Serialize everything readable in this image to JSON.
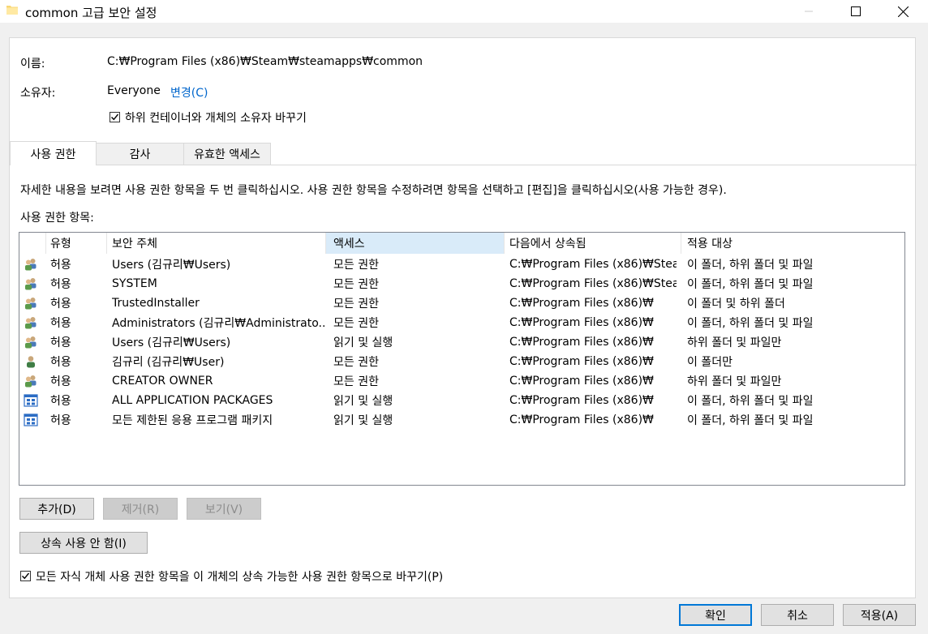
{
  "window": {
    "title": "common 고급 보안 설정",
    "min_symbol": "—",
    "max_symbol": "☐",
    "close_symbol": "✕"
  },
  "info": {
    "name_label": "이름:",
    "name_value": "C:₩Program Files (x86)₩Steam₩steamapps₩common",
    "owner_label": "소유자:",
    "owner_value": "Everyone",
    "change_link": "변경(C)",
    "replace_owner_checkbox": "하위 컨테이너와 개체의 소유자 바꾸기",
    "replace_owner_checked": true
  },
  "tabs": [
    {
      "label": "사용 권한",
      "active": true
    },
    {
      "label": "감사",
      "active": false
    },
    {
      "label": "유효한 액세스",
      "active": false
    }
  ],
  "instructions": "자세한 내용을 보려면 사용 권한 항목을 두 번 클릭하십시오. 사용 권한 항목을 수정하려면 항목을 선택하고 [편집]을 클릭하십시오(사용 가능한 경우).",
  "entries_label": "사용 권한 항목:",
  "table": {
    "columns": [
      "유형",
      "보안 주체",
      "액세스",
      "다음에서 상속됨",
      "적용 대상"
    ],
    "sorted_column": 2,
    "rows": [
      {
        "icon": "users-group-icon",
        "type": "허용",
        "principal": "Users (김규리₩Users)",
        "access": "모든 권한",
        "inherited": "C:₩Program Files (x86)₩Stea...",
        "applies": "이 폴더, 하위 폴더 및 파일"
      },
      {
        "icon": "users-group-icon",
        "type": "허용",
        "principal": "SYSTEM",
        "access": "모든 권한",
        "inherited": "C:₩Program Files (x86)₩Stea...",
        "applies": "이 폴더, 하위 폴더 및 파일"
      },
      {
        "icon": "users-group-icon",
        "type": "허용",
        "principal": "TrustedInstaller",
        "access": "모든 권한",
        "inherited": "C:₩Program Files (x86)₩",
        "applies": "이 폴더 및 하위 폴더"
      },
      {
        "icon": "users-group-icon",
        "type": "허용",
        "principal": "Administrators (김규리₩Administrato...",
        "access": "모든 권한",
        "inherited": "C:₩Program Files (x86)₩",
        "applies": "이 폴더, 하위 폴더 및 파일"
      },
      {
        "icon": "users-group-icon",
        "type": "허용",
        "principal": "Users (김규리₩Users)",
        "access": "읽기 및 실행",
        "inherited": "C:₩Program Files (x86)₩",
        "applies": "하위 폴더 및 파일만"
      },
      {
        "icon": "single-user-icon",
        "type": "허용",
        "principal": "김규리 (김규리₩User)",
        "access": "모든 권한",
        "inherited": "C:₩Program Files (x86)₩",
        "applies": "이 폴더만"
      },
      {
        "icon": "users-group-icon",
        "type": "허용",
        "principal": "CREATOR OWNER",
        "access": "모든 권한",
        "inherited": "C:₩Program Files (x86)₩",
        "applies": "하위 폴더 및 파일만"
      },
      {
        "icon": "app-package-icon",
        "type": "허용",
        "principal": "ALL APPLICATION PACKAGES",
        "access": "읽기 및 실행",
        "inherited": "C:₩Program Files (x86)₩",
        "applies": "이 폴더, 하위 폴더 및 파일"
      },
      {
        "icon": "app-package-icon",
        "type": "허용",
        "principal": "모든 제한된 응용 프로그램 패키지",
        "access": "읽기 및 실행",
        "inherited": "C:₩Program Files (x86)₩",
        "applies": "이 폴더, 하위 폴더 및 파일"
      }
    ]
  },
  "buttons": {
    "add": "추가(D)",
    "remove": "제거(R)",
    "view": "보기(V)",
    "disable_inheritance": "상속 사용 안 함(I)",
    "ok": "확인",
    "cancel": "취소",
    "apply": "적용(A)"
  },
  "replace_child_checkbox": "모든 자식 개체 사용 권한 항목을 이 개체의 상속 가능한 사용 권한 항목으로 바꾸기(P)",
  "replace_child_checked": true,
  "colors": {
    "link": "#0066cc",
    "sorted_header": "#d9ebf9",
    "default_button_border": "#0078d7"
  }
}
